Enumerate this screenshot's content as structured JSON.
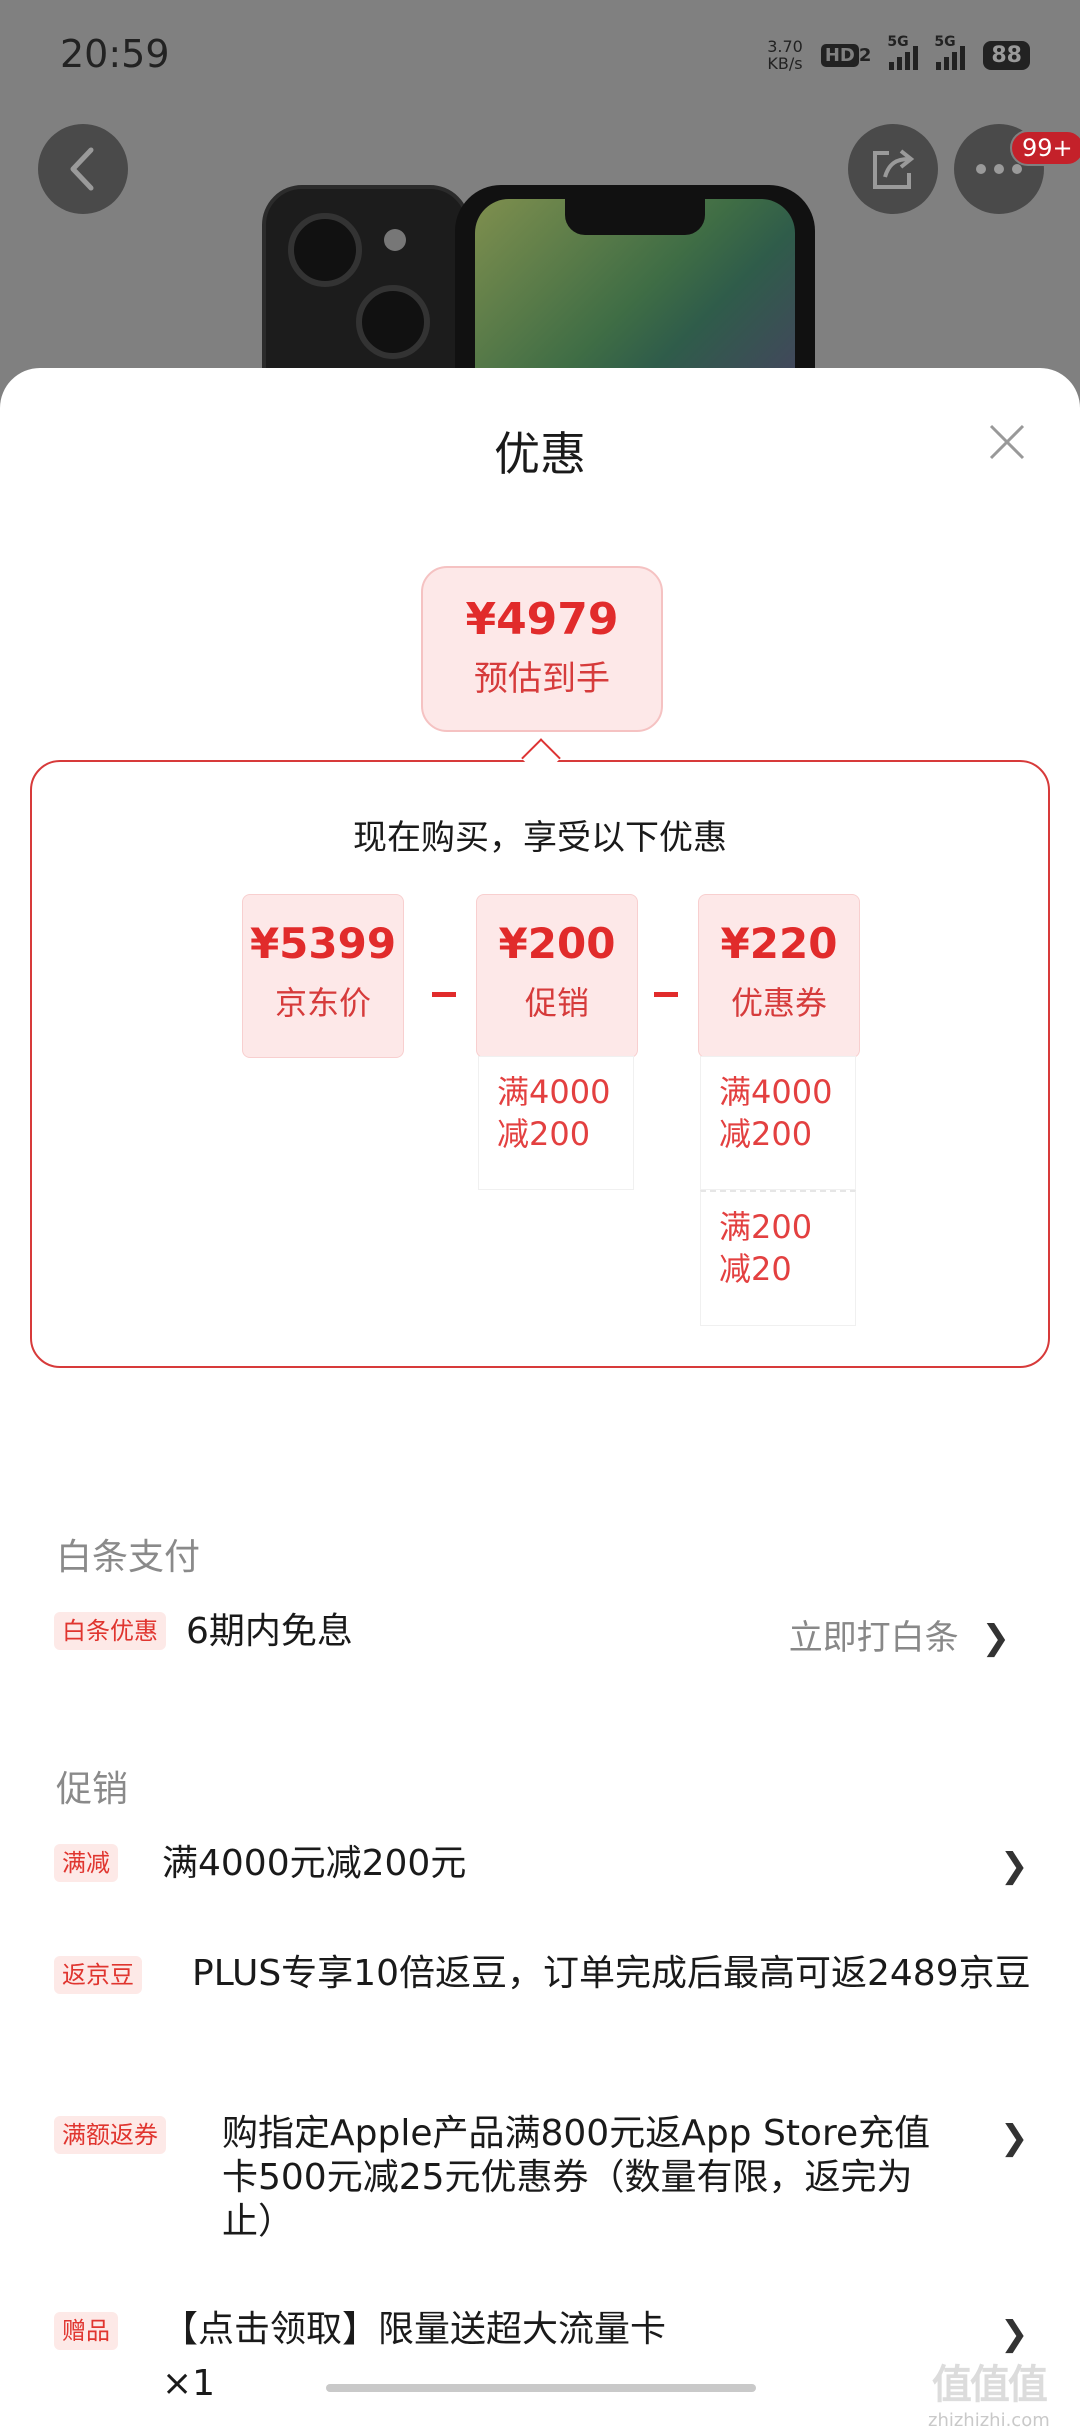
{
  "status_bar": {
    "time": "20:59",
    "net_speed_value": "3.70",
    "net_speed_unit": "KB/s",
    "hd_label": "HD",
    "sim_index": "2",
    "net1": "5G",
    "net2": "5G",
    "battery": "88"
  },
  "top_bar": {
    "back_icon": "chevron-left-icon",
    "share_icon": "share-icon",
    "more_icon": "more-dots-icon",
    "notification_badge": "99+"
  },
  "sheet": {
    "title": "优惠",
    "close_icon": "close-icon",
    "estimate": {
      "price": "¥4979",
      "label": "预估到手"
    },
    "breakdown": {
      "heading": "现在购买，享受以下优惠",
      "items": [
        {
          "value": "¥5399",
          "label": "京东价"
        },
        {
          "value": "¥200",
          "label": "促销",
          "conditions": [
            "满4000\n减200"
          ]
        },
        {
          "value": "¥220",
          "label": "优惠券",
          "conditions": [
            "满4000\n减200",
            "满200\n减20"
          ]
        }
      ]
    }
  },
  "baitiao": {
    "section_title": "白条支付",
    "tag": "白条优惠",
    "text": "6期内免息",
    "link": "立即打白条"
  },
  "promotions": {
    "section_title": "促销",
    "rows": [
      {
        "tag": "满减",
        "text": "满4000元减200元"
      },
      {
        "tag": "返京豆",
        "text": "PLUS专享10倍返豆，订单完成后最高可返2489京豆"
      },
      {
        "tag": "满额返券",
        "text": "购指定Apple产品满800元返App Store充值卡500元减25元优惠券（数量有限，返完为止）"
      },
      {
        "tag": "赠品",
        "text": "【点击领取】限量送超大流量卡",
        "extra": "×1"
      }
    ]
  },
  "watermark": {
    "text": "zhizhizhi.com",
    "mark": "值值值"
  },
  "colors": {
    "accent": "#e12b2b",
    "pink_bg": "#fde8e8",
    "tag_bg": "#fde9e7",
    "overlay": "#808080"
  }
}
